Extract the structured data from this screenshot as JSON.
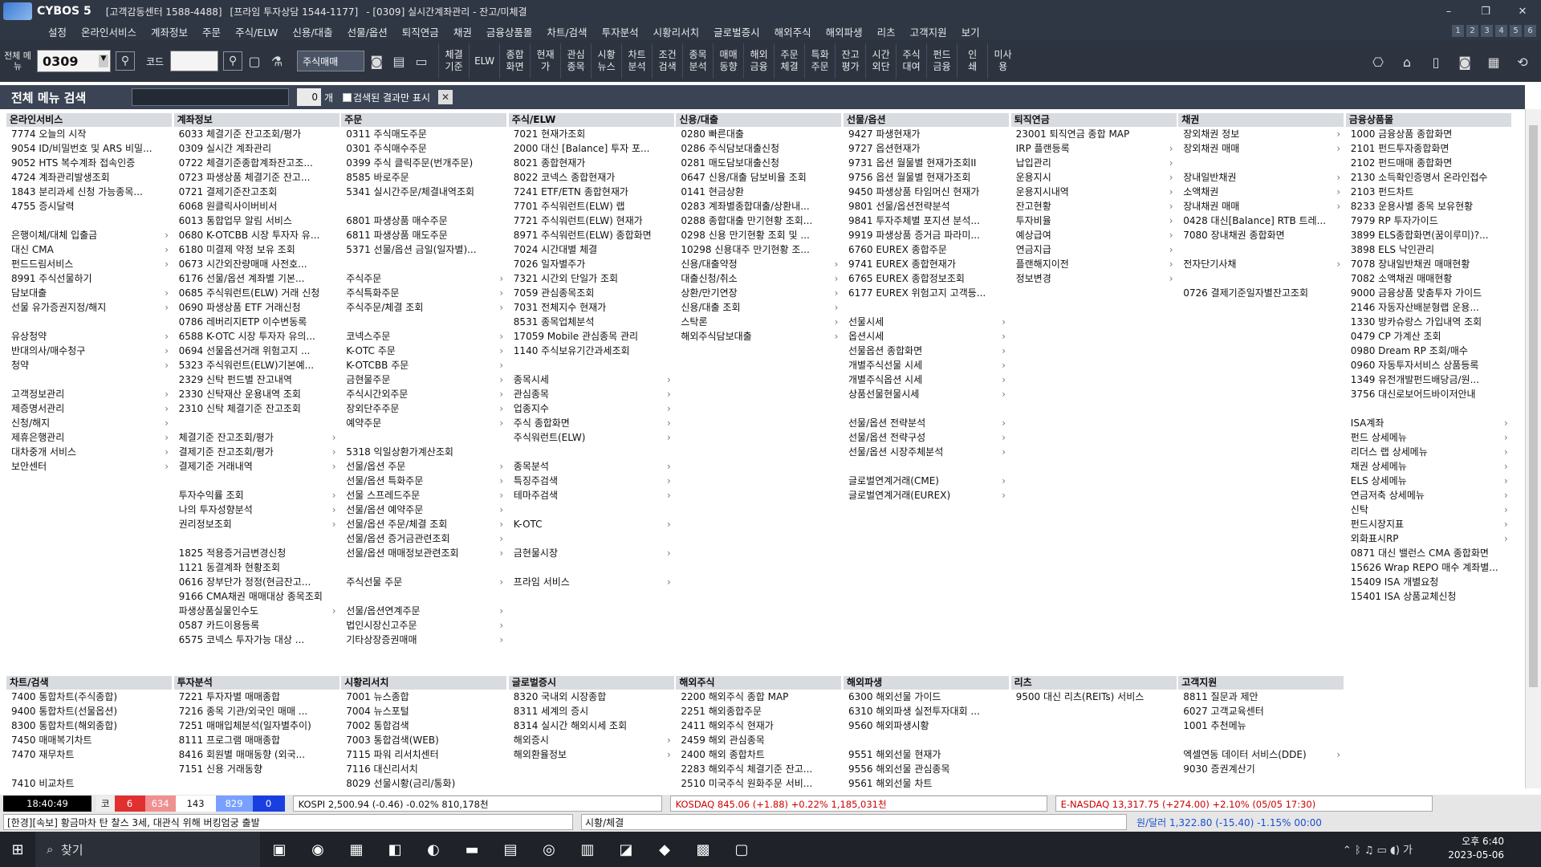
{
  "window": {
    "app_name": "CYBOS 5",
    "center": "[고객감동센터 1588-4488]",
    "premium": "[프라임 투자상담 1544-1177]",
    "screen": "- [0309] 실시간계좌관리 - 잔고/미체결",
    "controls": [
      "–",
      "❐",
      "✕"
    ]
  },
  "menu": [
    "설정",
    "온라인서비스",
    "계좌정보",
    "주문",
    "주식/ELW",
    "신용/대출",
    "선물/옵션",
    "퇴직연금",
    "채권",
    "금융상품몰",
    "차트/검색",
    "투자분석",
    "시황리서치",
    "글로벌증시",
    "해외주식",
    "해외파생",
    "리츠",
    "고객지원",
    "보기"
  ],
  "tabs": [
    "1",
    "2",
    "3",
    "4",
    "5",
    "6"
  ],
  "toolbar": {
    "allmenu": "전체\n메뉴",
    "code_value": "0309",
    "code_label": "코드",
    "order_select": "주식매매",
    "buttons": [
      "체결\n기준",
      "ELW",
      "종합\n화면",
      "현재\n가",
      "관심\n종목",
      "시황\n뉴스",
      "차트\n분석",
      "조건\n검색",
      "종목\n분석",
      "매매\n동향",
      "해외\n금융",
      "주문\n체결",
      "특화\n주문",
      "잔고\n평가",
      "시간\n외단",
      "주식\n대여",
      "펀드\n금융",
      "인\n쇄",
      "미사\n용"
    ]
  },
  "search": {
    "title": "전체 메뉴 검색",
    "count": "0",
    "count_unit": "개",
    "filter_label": "검색된 결과만 표시"
  },
  "columns_top": [
    {
      "title": "온라인서비스",
      "items": [
        "7774 오늘의 시작",
        "9054 ID/비밀번호 및 ARS 비밀...",
        "9052 HTS 복수계좌 접속인증",
        "4724 계좌관리발생조회",
        "1843 분리과세 신청 가능종목...",
        "4755 증시달력",
        "",
        "은행이체/대체 입출금|s",
        "대신 CMA|s",
        "펀드드림서비스|s",
        "8991 주식선물하기",
        "담보대출|s",
        "선물 유가증권지정/해지|s",
        "",
        "유상청약|s",
        "반대의사/매수청구|s",
        "청약|s",
        "",
        "고객정보관리|s",
        "제증명서관리|s",
        "신청/해지|s",
        "제휴은행관리|s",
        "대차중개 서비스|s",
        "보안센터|s"
      ]
    },
    {
      "title": "계좌정보",
      "items": [
        "6033 체결기준 잔고조회/평가",
        "0309 실시간 계좌관리",
        "0722 체결기준종합계좌잔고조...",
        "0723 파생상품 체결기준 잔고...",
        "0721 결제기준잔고조회",
        "6068 원클릭사이버비서",
        "6013 통합업무 알림 서비스",
        "0680 K-OTCBB 시장 투자자 유...",
        "6180 미결제 약정 보유 조회",
        "0673 시간외잔량매매 사전호...",
        "6176 선물/옵션 계좌별 기본...",
        "0685 주식워런트(ELW) 거래 신청",
        "0690 파생상품 ETF 거래신청",
        "0786 레버리지ETP 이수변동록",
        "6588 K-OTC 시장 투자자 유의...",
        "0694 선물옵션거래 위험고지 ...",
        "5323 주식워런트(ELW)기본예...",
        "2329 신탁 펀드별 잔고내역",
        "2330 신탁재산 운용내역 조회",
        "2310 신탁 체결기준 잔고조회",
        "",
        "체결기준 잔고조회/평가|s",
        "결제기준 잔고조회/평가|s",
        "결제기준 거래내역|s",
        "",
        "투자수익률 조회|s",
        "나의 투자성향분석|s",
        "권리정보조회|s",
        "",
        "1825 적용증거금변경신청",
        "1121 동결계좌 현황조회",
        "0616 장부단가 정정(현금잔고...",
        "9166 CMA채권 매매대상 종목조회",
        "파생상품실물인수도|s",
        "0587 카드이용등록",
        "6575 코넥스 투자가능 대상 ..."
      ]
    },
    {
      "title": "주문",
      "items": [
        "0311 주식매도주문",
        "0301 주식매수주문",
        "0399 주식 클릭주문(번개주문)",
        "8585 바로주문",
        "5341 실시간주문/체결내역조회",
        "",
        "6801 파생상품 매수주문",
        "6811 파생상품 매도주문",
        "5371 선물/옵션 금일(일자별)...",
        "",
        "주식주문|s",
        "주식특화주문|s",
        "주식주문/체결 조회|s",
        "",
        "코넥스주문|s",
        "K-OTC 주문|s",
        "K-OTCBB 주문|s",
        "금현물주문|s",
        "주식시간외주문|s",
        "장외단주주문|s",
        "예약주문|s",
        "",
        "5318 익일상환가계산조회",
        "선물/옵션 주문|s",
        "선물/옵션 특화주문|s",
        "선물 스프레드주문|s",
        "선물/옵션 예약주문|s",
        "선물/옵션 주문/체결 조회|s",
        "선물/옵션 증거금관련조회|s",
        "선물/옵션 매매정보관련조회|s",
        "",
        "주식선물 주문|s",
        "",
        "선물/옵션연계주문|s",
        "법인시장신고주문|s",
        "기타상장증권매매|s"
      ]
    },
    {
      "title": "주식/ELW",
      "items": [
        "7021 현재가조회",
        "2000 대신 [Balance] 투자 포...",
        "8021 종합현재가",
        "8022 코넥스 종합현재가",
        "7241 ETF/ETN 종합현재가",
        "7701 주식워런트(ELW) 랩",
        "7721 주식워런트(ELW) 현재가",
        "8971 주식워런트(ELW) 종합화면",
        "7024 시간대별 체결",
        "7026 일자별주가",
        "7321 시간외 단일가 조회",
        "7059 관심종목조회",
        "7031 전체지수 현재가",
        "8531 종목업체분석",
        "17059 Mobile 관심종목 관리",
        "1140 주식보유기간과세조회",
        "",
        "종목시세|s",
        "관심종목|s",
        "업종지수|s",
        "주식 종합화면|s",
        "주식워런트(ELW)|s",
        "",
        "종목분석|s",
        "특징주검색|s",
        "테마주검색|s",
        "",
        "K-OTC|s",
        "",
        "금현물시장|s",
        "",
        "프라임 서비스|s"
      ]
    },
    {
      "title": "신용/대출",
      "items": [
        "0280 빠른대출",
        "0286 주식담보대출신청",
        "0281 매도담보대출신청",
        "0647 신용/대출 담보비율 조회",
        "0141 현금상환",
        "0283 계좌별종합대출/상환내...",
        "0288 종합대출 만기현황 조회...",
        "0298 신용 만기현황 조회 및 ...",
        "10298 신용대주 만기현황 조...",
        "신용/대출약정|s",
        "대출신청/취소|s",
        "상환/만기연장|s",
        "신용/대출 조회|s",
        "스탁론|s",
        "해외주식담보대출|s"
      ]
    },
    {
      "title": "선물/옵션",
      "items": [
        "9427 파생현재가",
        "9727 옵션현재가",
        "9731 옵션 월물별 현재가조회II",
        "9756 옵션 월물별 현재가조회",
        "9450 파생상품 타임머신 현재가",
        "9801 선물/옵션전략분석",
        "9841 투자주체별 포지션 분석...",
        "9919 파생상품 증거금 파라미...",
        "6760 EUREX 종합주문",
        "9741 EUREX 종합현재가",
        "6765 EUREX 종합정보조회",
        "6177 EUREX 위험고지 고객등...",
        "",
        "선물시세|s",
        "옵션시세|s",
        "선물옵션 종합화면|s",
        "개별주식선물 시세|s",
        "개별주식옵션 시세|s",
        "상품선물현물시세|s",
        "",
        "선물/옵션 전략분석|s",
        "선물/옵션 전략구성|s",
        "선물/옵션 시장주체분석|s",
        "",
        "글로벌연계거래(CME)|s",
        "글로벌연계거래(EUREX)|s"
      ]
    },
    {
      "title": "퇴직연금",
      "items": [
        "23001 퇴직연금 종합 MAP",
        "IRP 플랜등록|s",
        "납입관리|s",
        "운용지시|s",
        "운용지시내역|s",
        "잔고현황|s",
        "투자비율|s",
        "예상급여|s",
        "연금지급|s",
        "플랜해지이전|s",
        "정보변경|s"
      ]
    },
    {
      "title": "채권",
      "items": [
        "장외채권 정보|s",
        "장외채권 매매|s",
        "",
        "장내일반채권|s",
        "소액채권|s",
        "장내채권 매매|s",
        "0428 대신[Balance] RTB 트레...",
        "7080 장내채권 종합화면",
        "",
        "전자단기사채|s",
        "",
        "0726 결제기준일자별잔고조회"
      ]
    },
    {
      "title": "금융상품몰",
      "items": [
        "1000 금융상품 종합화면",
        "2101 펀드투자종합화면",
        "2102 펀드매매 종합화면",
        "2130 소득확인증명서 온라인접수",
        "2103 펀드차트",
        "8233 운용사별 종목 보유현황",
        "7979 RP 투자가이드",
        "3899 ELS종합화면(꿈이루미)?...",
        "3898 ELS 낙인관리",
        "7078 장내일반채권 매매현황",
        "7082 소액채권 매매현황",
        "9000 금융상품 맞춤투자 가이드",
        "2146 자동자산배분형랩 운용...",
        "1330 방카슈랑스 가입내역 조회",
        "0479 CP 가계산 조회",
        "0980 Dream RP 조회/매수",
        "0960 자동투자서비스 상품등록",
        "1349 유전개발펀드배당금/원...",
        "3756 대신로보어드바이저안내",
        "",
        "ISA계좌|s",
        "펀드 상세메뉴|s",
        "리더스 랩 상세메뉴|s",
        "채권 상세메뉴|s",
        "ELS 상세메뉴|s",
        "연금저축 상세메뉴|s",
        "신탁|s",
        "펀드시장지표|s",
        "외화표시RP|s",
        "0871 대신 밸런스 CMA 종합화면",
        "15626 Wrap REPO 매수 계좌별...",
        "15409 ISA 개별요청",
        "15401 ISA 상품교체신청"
      ]
    }
  ],
  "columns_bottom": [
    {
      "title": "차트/검색",
      "items": [
        "7400 통합차트(주식종합)",
        "9400 통합차트(선물옵션)",
        "8300 통합차트(해외종합)",
        "7450 매매복기차트",
        "7470 재무차트",
        "",
        "7410 비교차트"
      ]
    },
    {
      "title": "투자분석",
      "items": [
        "7221 투자자별 매매종합",
        "7216 종목 기관/외국인 매매 ...",
        "7251 매매입체분석(일자별추이)",
        "8111 프로그램 매매종합",
        "8416 회원별 매매동향 (외국...",
        "7151 신용 거래동향"
      ]
    },
    {
      "title": "시황리서치",
      "items": [
        "7001 뉴스종합",
        "7004 뉴스포털",
        "7002 통합검색",
        "7003 통합검색(WEB)",
        "7115 파워 리서치센터",
        "7116 대신리서치",
        "8029 선물시황(금리/통화)"
      ]
    },
    {
      "title": "글로벌증시",
      "items": [
        "8320 국내외 시장종합",
        "8311 세계의 증시",
        "8314 실시간 해외시세 조회",
        "해외증시|s",
        "해외환율정보|s"
      ]
    },
    {
      "title": "해외주식",
      "items": [
        "2200 해외주식 종합 MAP",
        "2251 해외종합주문",
        "2411 해외주식 현재가",
        "2459 해외 관심종목",
        "2400 해외 종합차트",
        "2283 해외주식 체결기준 잔고...",
        "2510 미국주식 원화주문 서비..."
      ]
    },
    {
      "title": "해외파생",
      "items": [
        "6300 해외선물 가이드",
        "6310 해외파생 실전투자대회 ...",
        "9560 해외파생시황",
        "",
        "9551 해외선물 현재가",
        "9556 해외선물 관심종목",
        "9561 해외선물 차트"
      ]
    },
    {
      "title": "리츠",
      "items": [
        "9500 대신 리츠(REITs) 서비스"
      ]
    },
    {
      "title": "고객지원",
      "items": [
        "8811 질문과 제안",
        "6027 고객교육센터",
        "1001 추천메뉴",
        "",
        "엑셀연동 데이터 서비스(DDE)|s",
        "9030 증권계산기"
      ]
    }
  ],
  "status": {
    "time": "18:40:49",
    "counts": [
      "코",
      "6",
      "634",
      "143",
      "829",
      "0"
    ],
    "kospi": "KOSPI  2,500.94 (-0.46) -0.02%  810,178천",
    "kosdaq": "KOSDAQ  845.06 (+1.88) +0.22%  1,185,031천",
    "nasdaq": "E-NASDAQ  13,317.75 (+274.00) +2.10% (05/05 17:30)",
    "news": "[한경][속보] 황금마차 탄 찰스 3세, 대관식 위해 버킹엄궁 출발",
    "category": "시황/체결",
    "fx": "원/달러  1,322.80 (-15.40) -1.15%  00:00"
  },
  "taskbar": {
    "search": "찾기",
    "time": "오후 6:40",
    "date": "2023-05-06",
    "lang": "가"
  }
}
